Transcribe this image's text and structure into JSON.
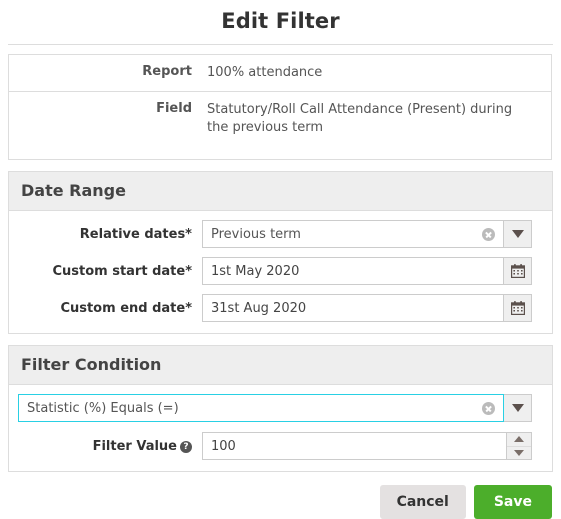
{
  "dialog": {
    "title": "Edit Filter"
  },
  "info": {
    "rows": [
      {
        "label": "Report",
        "value": "100% attendance"
      },
      {
        "label": "Field",
        "value": "Statutory/Roll Call Attendance (Present) during the previous term"
      }
    ]
  },
  "date_range": {
    "heading": "Date Range",
    "relative_dates": {
      "label": "Relative dates*",
      "value": "Previous term",
      "clear_icon": "clear-circle-icon",
      "dropdown_icon": "chevron-down-icon"
    },
    "custom_start_date": {
      "label": "Custom start date*",
      "value": "1st May 2020",
      "placeholder": "",
      "icon": "calendar-icon"
    },
    "custom_end_date": {
      "label": "Custom end date*",
      "value": "31st Aug 2020",
      "placeholder": "",
      "icon": "calendar-icon"
    }
  },
  "filter_condition": {
    "heading": "Filter Condition",
    "condition": {
      "value": "Statistic (%) Equals (=)",
      "focused": true,
      "clear_icon": "clear-circle-icon",
      "dropdown_icon": "chevron-down-icon"
    },
    "filter_value": {
      "label": "Filter Value",
      "help_icon": "help-circle-icon",
      "help_glyph": "?",
      "value": "100",
      "placeholder": "",
      "spinner_up_icon": "caret-up-icon",
      "spinner_down_icon": "caret-down-icon"
    }
  },
  "footer": {
    "cancel_label": "Cancel",
    "save_label": "Save"
  },
  "colors": {
    "focus_border": "#29d0e4",
    "save_button": "#4cae2b",
    "cancel_button": "#e4e1e1",
    "panel_header": "#eeeeee",
    "border": "#dddddd"
  }
}
